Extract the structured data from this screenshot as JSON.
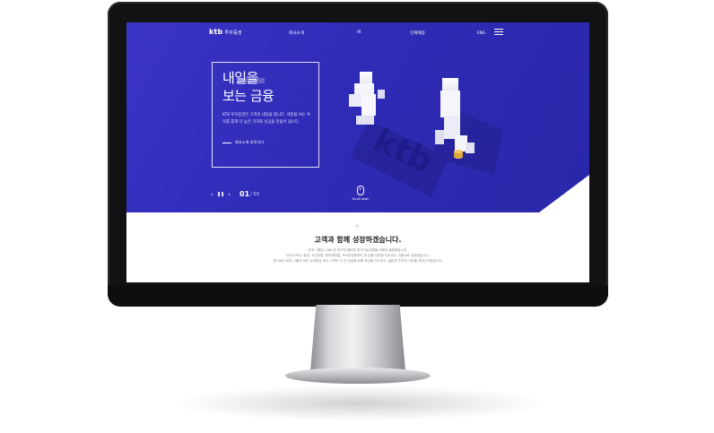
{
  "nav": {
    "logo": "ktb",
    "logo_sub": "투자증권",
    "items": [
      "회사소개",
      "IR",
      "인재채용"
    ],
    "lang": "ENG"
  },
  "hero": {
    "headline_1": "내일을",
    "headline_2": "보는 금융",
    "description": "KTB 투자증권은 고객의 내일을 봅니다. 내일을 보는 투자를 통해 더 높은 가치와 성공을 만들어 냅니다.",
    "more_label": "회사소개 바로가기",
    "pager_current": "01",
    "pager_total": "/ 03",
    "scroll_label": "Scroll down",
    "brand_3d_text": "ktb"
  },
  "content": {
    "title": "고객과 함께 성장하겠습니다.",
    "paragraphs": [
      "KTB 그룹은 1981년 한국의 올바른 한국기술개발을 위해여 출범했습니다.",
      "이후 KTB는 증권, 자산운용, 벤처캐피탈, 프라이빗에퀴티 등 금융 전반을 아우르는 그룹으로 성장했습니다.",
      "앞으로도 KTB 그룹과 모든 임직원은 모두 고객의 더 큰 성공을 위해 혁신을 선도하고, 올바른 투자의 기준을 세워나가겠습니다."
    ]
  },
  "colors": {
    "hero_bg": "#3231BD",
    "accent": "#ffffff"
  }
}
